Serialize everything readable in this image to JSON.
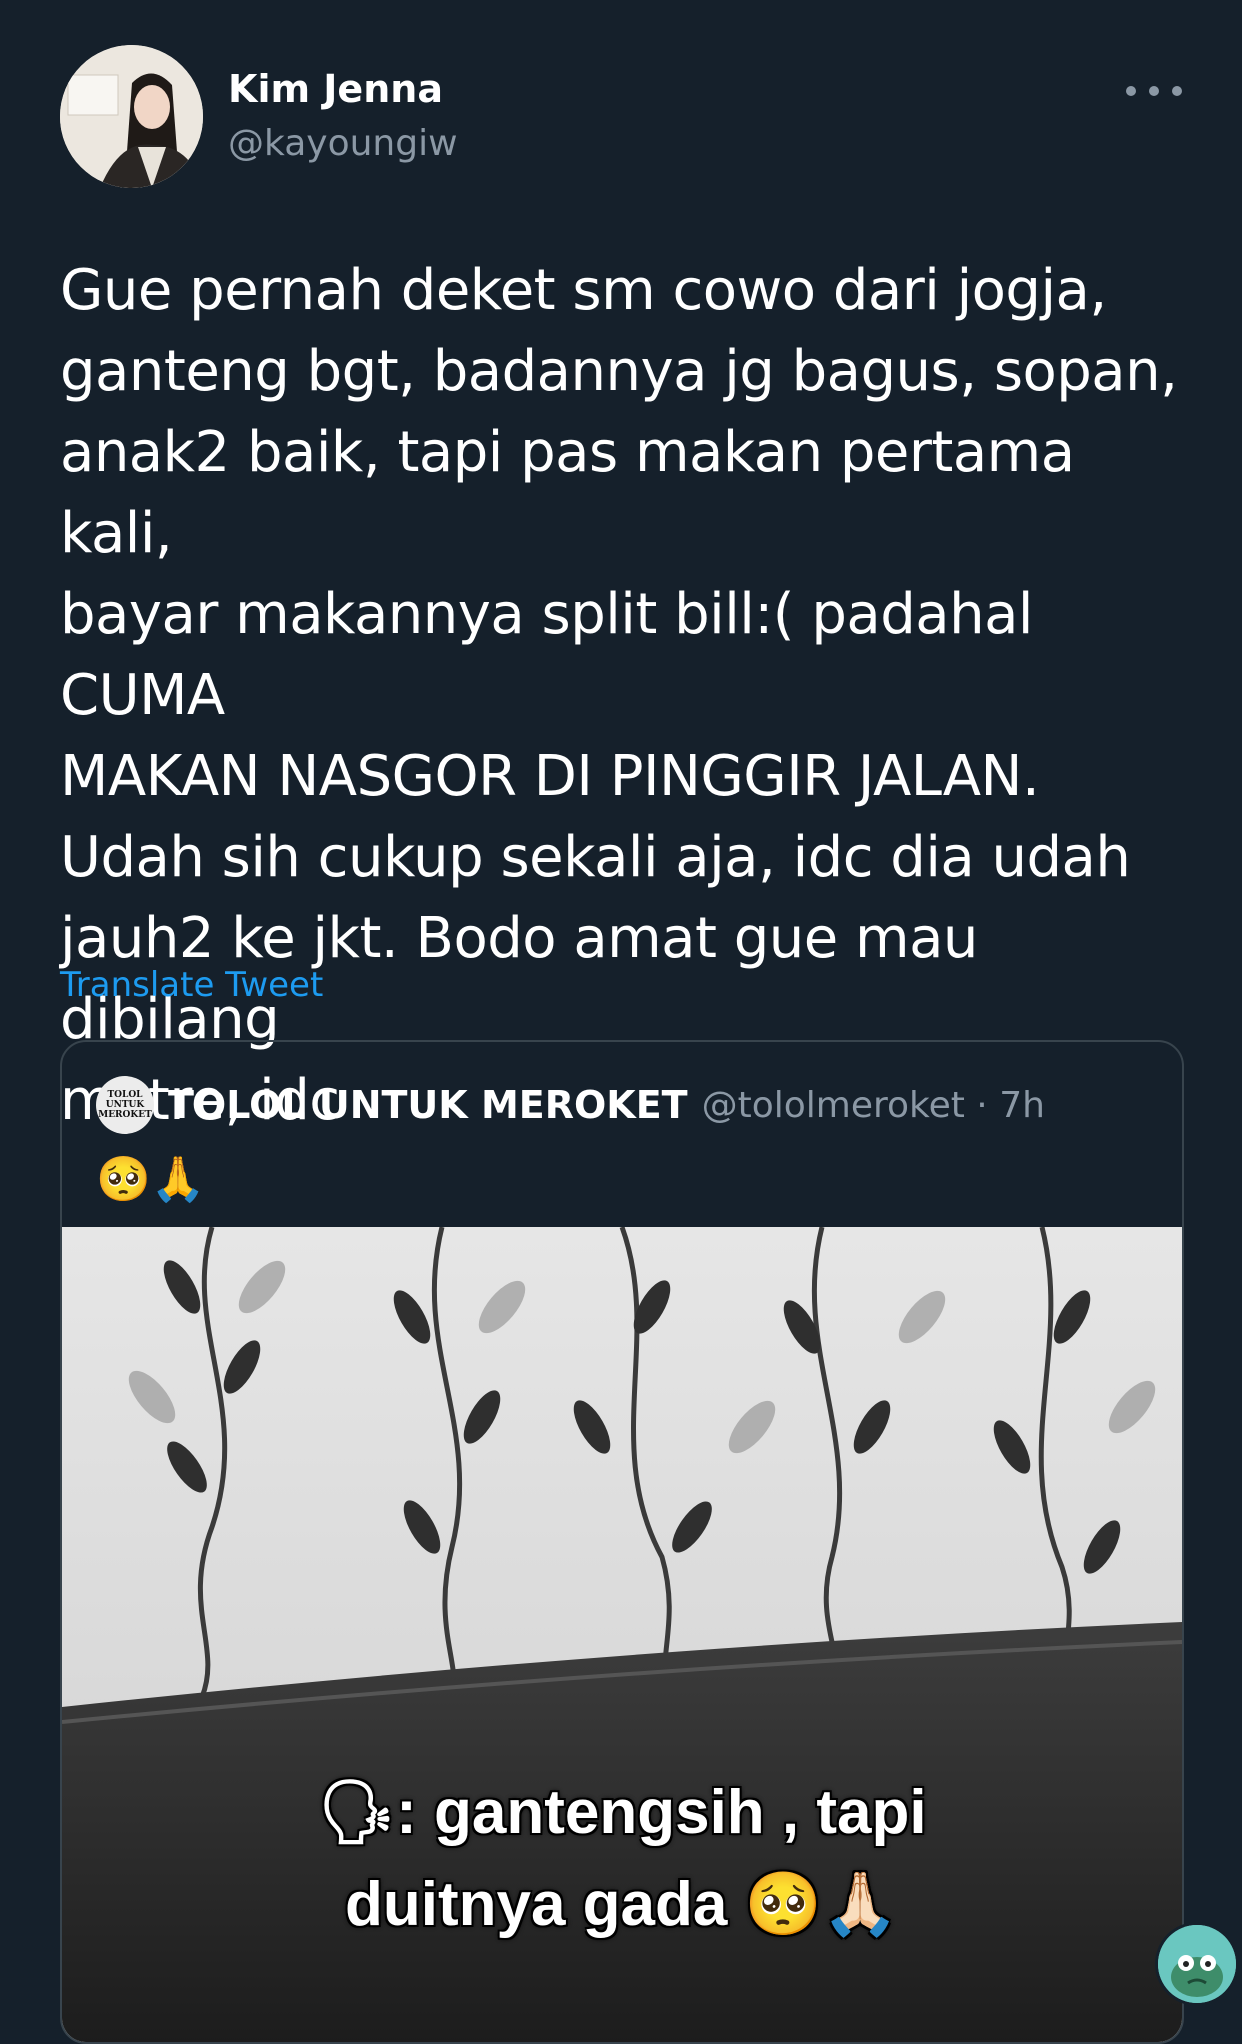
{
  "author": {
    "name": "Kim Jenna",
    "handle": "@kayoungiw",
    "avatar_icon": "profile-photo"
  },
  "more_icon": "more-horizontal-icon",
  "tweet": {
    "text": "Gue pernah deket sm cowo dari jogja,\nganteng bgt, badannya jg bagus, sopan,\nanak2 baik, tapi pas makan pertama kali,\nbayar makannya split bill:( padahal CUMA\nMAKAN NASGOR DI PINGGIR JALAN.\nUdah sih cukup sekali aja, idc dia udah\njauh2 ke jkt. Bodo amat gue mau dibilang\nmatre, idc",
    "translate_label": "Translate Tweet"
  },
  "quoted_tweet": {
    "avatar_text": [
      "TOLOL",
      "UNTUK",
      "MEROKET"
    ],
    "name": "TOLOL UNTUK MEROKET",
    "handle_time": "@tololmeroket · 7h",
    "text": "🥺🙏",
    "media_caption_line1": "🗣: gantengsih , tapi",
    "media_caption_line2": "duitnya gada 🥺🙏🏻"
  },
  "colors": {
    "background": "#15202b",
    "link": "#1d9bf0",
    "secondary_text": "#8b98a5",
    "border": "#38444d"
  }
}
